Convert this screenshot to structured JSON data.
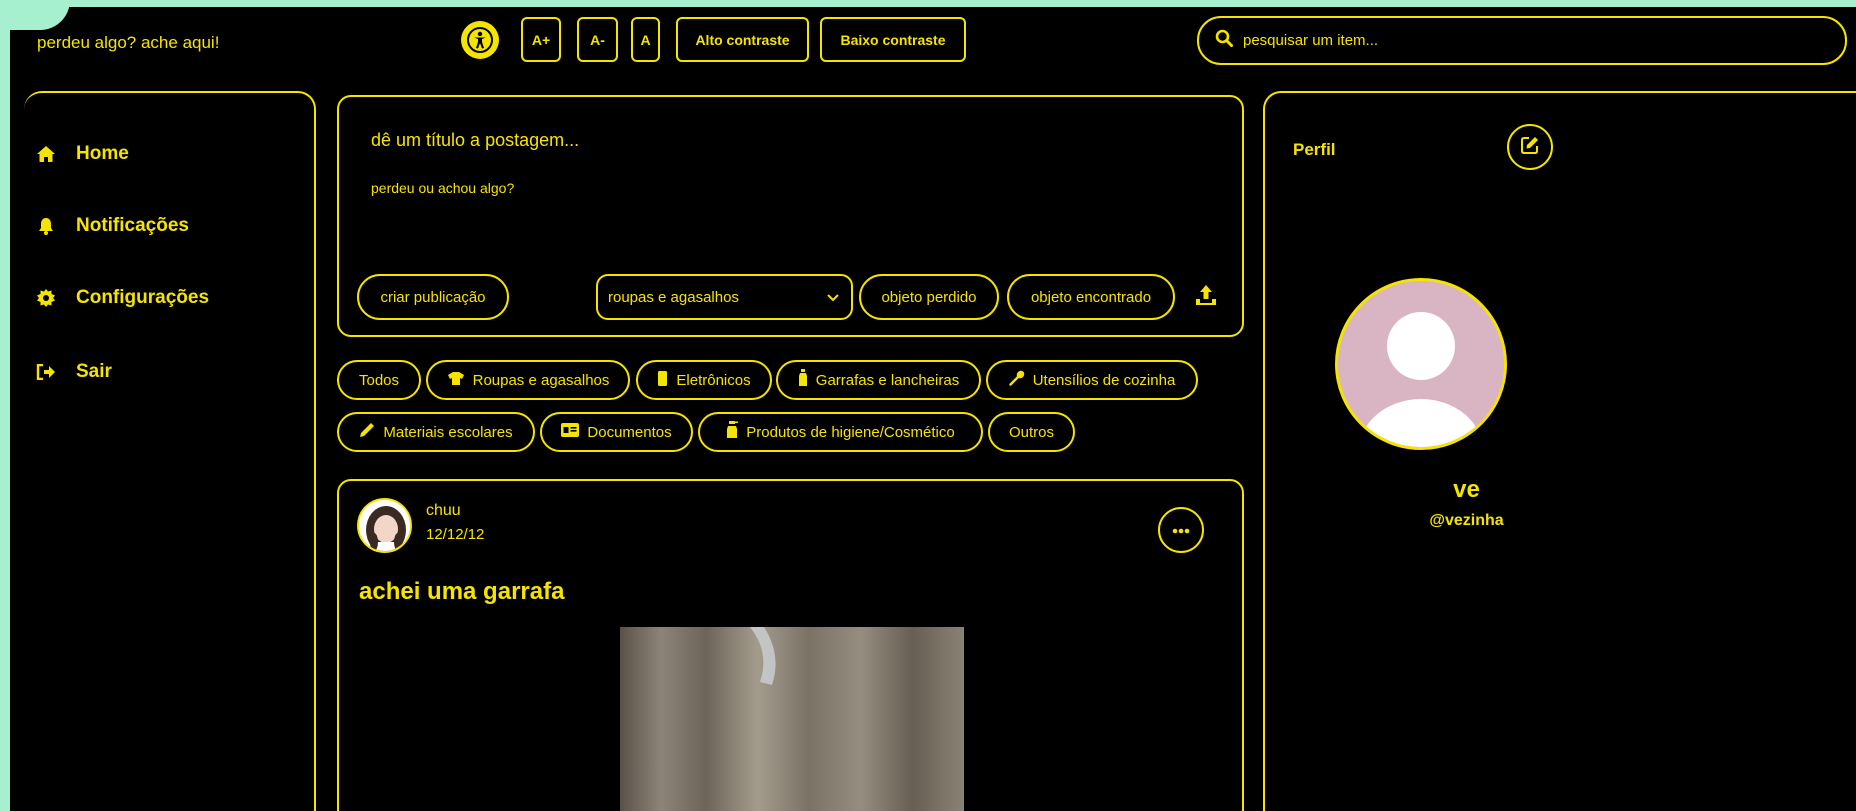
{
  "brand": "perdeu algo? ache aqui!",
  "toolbar": {
    "font_increase": "A+",
    "font_decrease": "A-",
    "font_reset": "A",
    "high_contrast": "Alto contraste",
    "low_contrast": "Baixo contraste"
  },
  "search": {
    "placeholder": "pesquisar um item..."
  },
  "sidebar": {
    "items": [
      {
        "label": "Home",
        "icon": "home-icon"
      },
      {
        "label": "Notificações",
        "icon": "bell-icon"
      },
      {
        "label": "Configurações",
        "icon": "gear-icon"
      },
      {
        "label": "Sair",
        "icon": "logout-icon"
      }
    ]
  },
  "composer": {
    "title_placeholder": "dê um título a postagem...",
    "body_placeholder": "perdeu ou achou algo?",
    "create_label": "criar publicação",
    "category_selected": "roupas e agasalhos",
    "lost_label": "objeto perdido",
    "found_label": "objeto encontrado"
  },
  "filters": [
    {
      "label": "Todos",
      "icon": ""
    },
    {
      "label": "Roupas e agasalhos",
      "icon": "shirt-icon"
    },
    {
      "label": "Eletrônicos",
      "icon": "phone-icon"
    },
    {
      "label": "Garrafas e lancheiras",
      "icon": "bottle-icon"
    },
    {
      "label": "Utensílios de cozinha",
      "icon": "spoon-icon"
    },
    {
      "label": "Materiais escolares",
      "icon": "pencil-icon"
    },
    {
      "label": "Documentos",
      "icon": "id-card-icon"
    },
    {
      "label": "Produtos de higiene/Cosmético",
      "icon": "spray-bottle-icon"
    },
    {
      "label": "Outros",
      "icon": ""
    }
  ],
  "post": {
    "author": "chuu",
    "date": "12/12/12",
    "title": "achei uma garrafa"
  },
  "profile": {
    "title": "Perfil",
    "name": "ve",
    "handle": "@vezinha"
  },
  "colors": {
    "accent": "#f5e400",
    "background": "#000000",
    "edge": "#a6f0cf"
  }
}
